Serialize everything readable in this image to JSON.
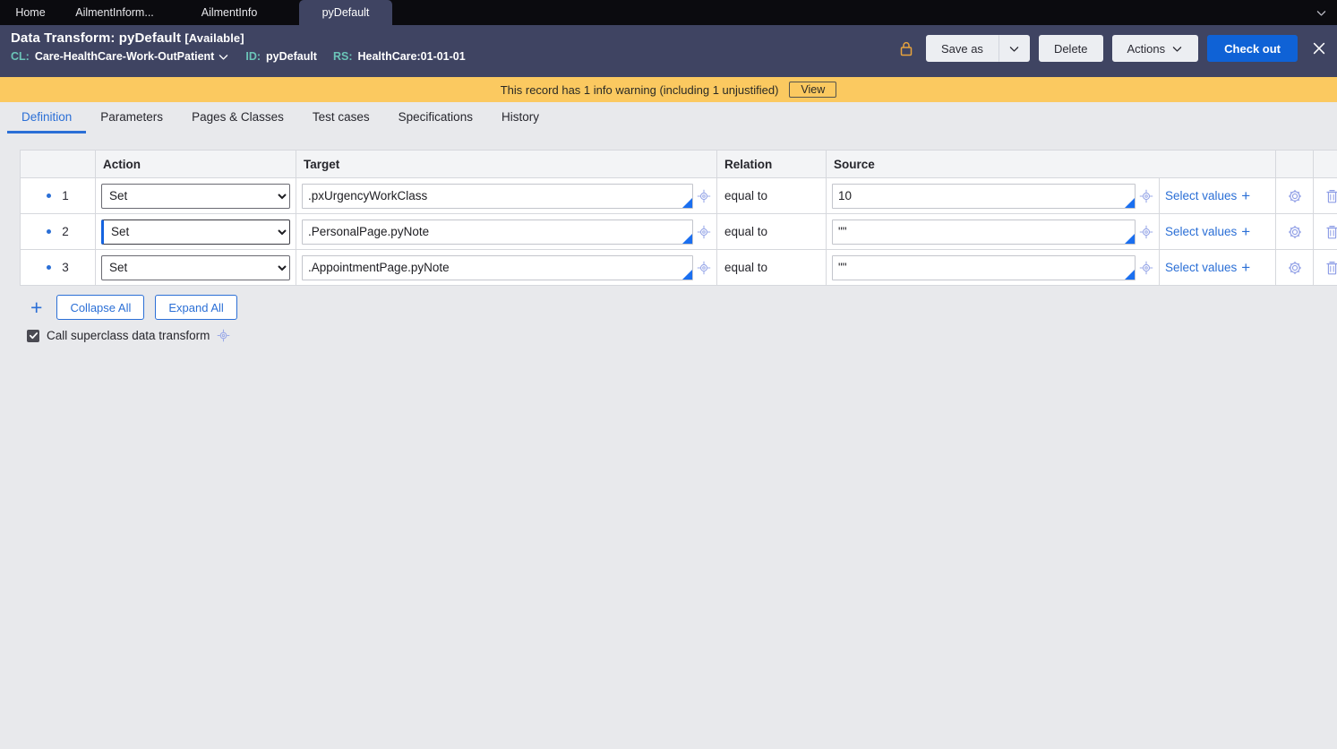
{
  "browser_tabs": {
    "items": [
      {
        "label": "Home",
        "active": false
      },
      {
        "label": "AilmentInform...",
        "active": false
      },
      {
        "label": "AilmentInfo",
        "active": false
      },
      {
        "label": "pyDefault",
        "active": true
      }
    ],
    "overflow_icon": "chevron-down-icon"
  },
  "header": {
    "title_prefix": "Data Transform: pyDefault",
    "status": "[Available]",
    "class_label": "CL:",
    "class_value": "Care-HealthCare-Work-OutPatient",
    "class_chevron_icon": "chevron-down-icon",
    "id_label": "ID:",
    "id_value": "pyDefault",
    "ruleset_label": "RS:",
    "ruleset_value": "HealthCare:01-01-01",
    "lock_icon": "lock-icon",
    "background_color": "#3f4462",
    "actions": {
      "save_as": "Save as",
      "save_as_caret_icon": "chevron-down-icon",
      "delete": "Delete",
      "actions": "Actions",
      "actions_caret_icon": "chevron-down-icon",
      "check_out": "Check out",
      "check_out_color": "#0f62d6",
      "close_icon": "close-icon"
    }
  },
  "warning_banner": {
    "message": "This record has 1 info warning (including 1 unjustified)",
    "view_label": "View",
    "background_color": "#fbc960"
  },
  "nav_tabs": {
    "items": [
      {
        "label": "Definition",
        "active": true
      },
      {
        "label": "Parameters",
        "active": false
      },
      {
        "label": "Pages & Classes",
        "active": false
      },
      {
        "label": "Test cases",
        "active": false
      },
      {
        "label": "Specifications",
        "active": false
      },
      {
        "label": "History",
        "active": false
      }
    ],
    "active_color": "#2b6fd6"
  },
  "table": {
    "columns": [
      "",
      "Action",
      "Target",
      "Relation",
      "Source",
      "",
      "",
      ""
    ],
    "headers": {
      "num": "",
      "action": "Action",
      "target": "Target",
      "relation": "Relation",
      "source": "Source",
      "selvals": "",
      "gear": "",
      "del": ""
    },
    "rows": [
      {
        "number": "1",
        "action": "Set",
        "target": ".pxUrgencyWorkClass",
        "relation": "equal to",
        "source": "10",
        "select_values": "Select values",
        "select_values_plus": "+",
        "action_focused": false
      },
      {
        "number": "2",
        "action": "Set",
        "target": ".PersonalPage.pyNote",
        "relation": "equal to",
        "source": "\"\"",
        "select_values": "Select values",
        "select_values_plus": "+",
        "action_focused": true
      },
      {
        "number": "3",
        "action": "Set",
        "target": ".AppointmentPage.pyNote",
        "relation": "equal to",
        "source": "\"\"",
        "select_values": "Select values",
        "select_values_plus": "+",
        "action_focused": false
      }
    ],
    "icons": {
      "target_picker": "crosshair-icon",
      "source_picker": "crosshair-icon",
      "settings": "gear-icon",
      "delete": "trash-icon"
    }
  },
  "footer": {
    "add_row_icon": "plus-icon",
    "collapse_all": "Collapse All",
    "expand_all": "Expand All",
    "superclass_label": "Call superclass data transform",
    "superclass_checked": true,
    "superclass_help_icon": "crosshair-icon"
  }
}
